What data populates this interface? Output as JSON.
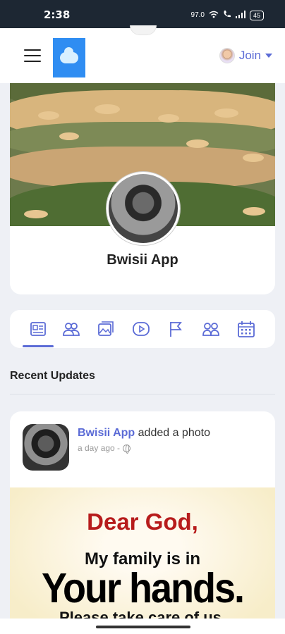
{
  "status_bar": {
    "time": "2:38",
    "speed": "97.0",
    "battery": "45"
  },
  "header": {
    "join_label": "Join"
  },
  "profile": {
    "name": "Bwisii App"
  },
  "tabs": [
    {
      "icon": "news-feed-icon",
      "active": true
    },
    {
      "icon": "friends-icon"
    },
    {
      "icon": "photos-icon"
    },
    {
      "icon": "videos-icon"
    },
    {
      "icon": "pages-flag-icon"
    },
    {
      "icon": "groups-icon"
    },
    {
      "icon": "events-calendar-icon"
    }
  ],
  "recent_updates": {
    "title": "Recent Updates"
  },
  "post": {
    "author": "Bwisii App",
    "action": "added a photo",
    "time": "a day ago -",
    "image_text": {
      "line1": "Dear God,",
      "line2": "My family is in",
      "line3": "Your hands.",
      "line4": "Please take care of us."
    }
  },
  "colors": {
    "accent": "#5b6bd6",
    "logo_blue": "#2f8df2",
    "status_bar": "#1d2733",
    "page_bg": "#eef0f5"
  }
}
